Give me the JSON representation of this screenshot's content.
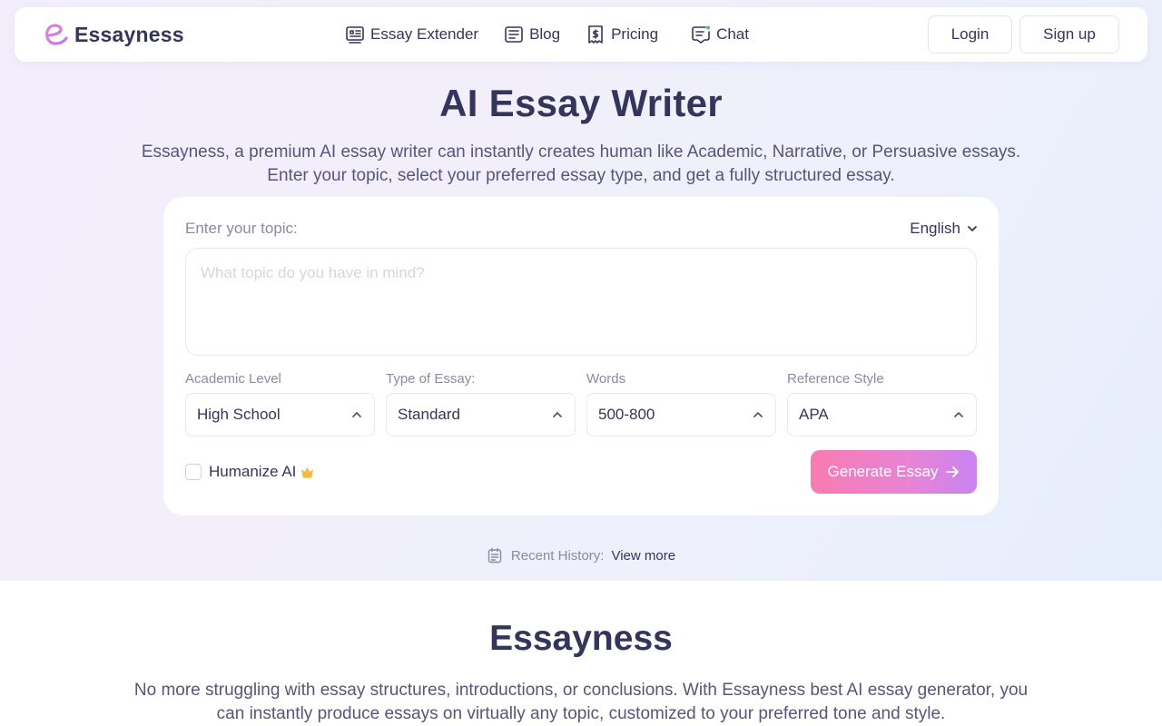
{
  "brand": {
    "name": "Essayness",
    "accent": "#c07ae6"
  },
  "nav": {
    "links": [
      {
        "label": "Essay Extender",
        "icon": "essay-extender-icon"
      },
      {
        "label": "Blog",
        "icon": "blog-icon"
      },
      {
        "label": "Pricing",
        "icon": "pricing-icon"
      },
      {
        "label": "Chat",
        "icon": "chat-icon"
      }
    ],
    "login": "Login",
    "signup": "Sign up"
  },
  "hero": {
    "title": "AI Essay Writer",
    "subtitle": "Essayness, a premium AI essay writer can instantly creates human like Academic, Narrative, or Persuasive essays. Enter your topic, select your preferred essay type, and get a fully structured essay."
  },
  "form": {
    "topic_label": "Enter your topic:",
    "language": "English",
    "topic_placeholder": "What topic do you have in mind?",
    "topic_value": "",
    "fields": [
      {
        "label": "Academic Level",
        "value": "High School"
      },
      {
        "label": "Type of Essay:",
        "value": "Standard"
      },
      {
        "label": "Words",
        "value": "500-800"
      },
      {
        "label": "Reference Style",
        "value": "APA"
      }
    ],
    "humanize_label": "Humanize AI",
    "humanize_checked": false,
    "generate_label": "Generate Essay",
    "generate_gradient": [
      "#f97bb1",
      "#c983f2"
    ]
  },
  "history": {
    "label": "Recent History:",
    "link": "View more"
  },
  "section": {
    "title": "Essayness",
    "text": "No more struggling with essay structures, introductions, or conclusions. With Essayness best AI essay generator, you can instantly produce essays on virtually any topic, customized to your preferred tone and style."
  }
}
